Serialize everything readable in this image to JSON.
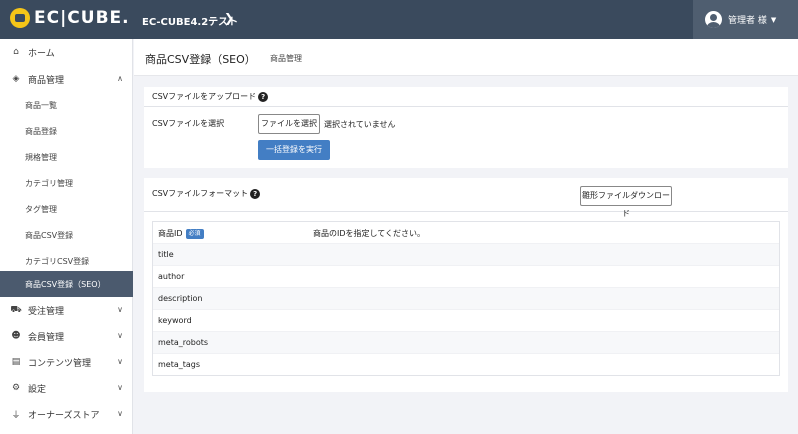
{
  "header": {
    "logo_text": "EC|CUBE.",
    "site_name": "EC-CUBE4.2テスト",
    "site_arrow": "❯",
    "user_name": "管理者 様",
    "user_caret": "▼"
  },
  "sidebar": {
    "home": "ホーム",
    "product_mgmt": "商品管理",
    "sub_items": [
      "商品一覧",
      "商品登録",
      "規格管理",
      "カテゴリ管理",
      "タグ管理",
      "商品CSV登録",
      "カテゴリCSV登録",
      "商品CSV登録（SEO）"
    ],
    "order_mgmt": "受注管理",
    "customer_mgmt": "会員管理",
    "content_mgmt": "コンテンツ管理",
    "settings": "設定",
    "owners_store": "オーナーズストア"
  },
  "page": {
    "title": "商品CSV登録（SEO）",
    "subtitle": "商品管理"
  },
  "upload": {
    "title": "CSVファイルをアップロード",
    "field_label": "CSVファイルを選択",
    "file_button": "ファイルを選択",
    "file_status": "選択されていません",
    "submit_button": "一括登録を実行"
  },
  "format": {
    "title": "CSVファイルフォーマット",
    "download_button": "雛形ファイルダウンロード",
    "required_badge": "必須",
    "rows": [
      {
        "name": "商品ID",
        "description": "商品のIDを指定してください。"
      },
      {
        "name": "title",
        "description": ""
      },
      {
        "name": "author",
        "description": ""
      },
      {
        "name": "description",
        "description": ""
      },
      {
        "name": "keyword",
        "description": ""
      },
      {
        "name": "meta_robots",
        "description": ""
      },
      {
        "name": "meta_tags",
        "description": ""
      }
    ]
  }
}
